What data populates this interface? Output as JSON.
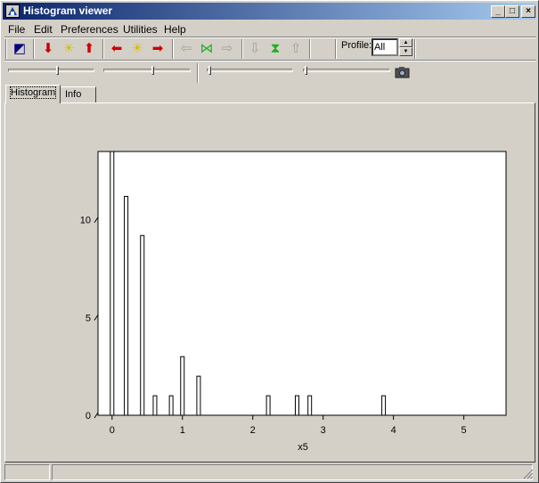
{
  "window": {
    "title": "Histogram viewer"
  },
  "title_buttons": {
    "minimize": "_",
    "maximize": "□",
    "close": "×"
  },
  "menu": [
    "File",
    "Edit",
    "Preferences",
    "Utilities",
    "Help"
  ],
  "toolbar": {
    "icons": [
      {
        "name": "new-window-icon",
        "glyph": "◩",
        "color": "#000080"
      },
      {
        "name": "arrow-down-red-icon",
        "glyph": "⬇",
        "color": "#cc0000"
      },
      {
        "name": "sun-icon",
        "glyph": "☀",
        "color": "#d8c000"
      },
      {
        "name": "arrow-up-red-icon",
        "glyph": "⬆",
        "color": "#cc0000"
      },
      {
        "name": "arrow-left-red-icon",
        "glyph": "⬅",
        "color": "#cc0000"
      },
      {
        "name": "sun-icon",
        "glyph": "☀",
        "color": "#d8c000"
      },
      {
        "name": "arrow-right-red-icon",
        "glyph": "➡",
        "color": "#cc0000"
      },
      {
        "name": "arrow-left-disabled-icon",
        "glyph": "⇦",
        "color": "#a0a0a0"
      },
      {
        "name": "fit-horizontal-icon",
        "glyph": "⋈",
        "color": "#20b020"
      },
      {
        "name": "arrow-right-disabled-icon",
        "glyph": "⇨",
        "color": "#a0a0a0"
      },
      {
        "name": "arrow-down-disabled-icon",
        "glyph": "⇩",
        "color": "#a0a0a0"
      },
      {
        "name": "fit-vertical-icon",
        "glyph": "⧗",
        "color": "#20b020"
      },
      {
        "name": "arrow-up-disabled-icon",
        "glyph": "⇧",
        "color": "#a0a0a0"
      }
    ],
    "profile_label": "Profile:",
    "profile_value": "All",
    "camera_icon": "camera-icon"
  },
  "tabs": [
    "Histogram",
    "Info"
  ],
  "chart_data": {
    "type": "bar",
    "xlabel": "x5",
    "ylabel": "",
    "xlim": [
      -0.2,
      5.6
    ],
    "ylim": [
      0,
      13.5
    ],
    "x_ticks": [
      "0",
      "1",
      "2",
      "3",
      "4",
      "5"
    ],
    "y_ticks": [
      "0",
      "5",
      "10"
    ],
    "bars": [
      {
        "x": 0.0,
        "value": 13.5
      },
      {
        "x": 0.2,
        "value": 11.2
      },
      {
        "x": 0.43,
        "value": 9.2
      },
      {
        "x": 0.61,
        "value": 1.0
      },
      {
        "x": 0.84,
        "value": 1.0
      },
      {
        "x": 1.0,
        "value": 3.0
      },
      {
        "x": 1.23,
        "value": 2.0
      },
      {
        "x": 2.22,
        "value": 1.0
      },
      {
        "x": 2.63,
        "value": 1.0
      },
      {
        "x": 2.81,
        "value": 1.0
      },
      {
        "x": 3.86,
        "value": 1.0
      }
    ]
  }
}
